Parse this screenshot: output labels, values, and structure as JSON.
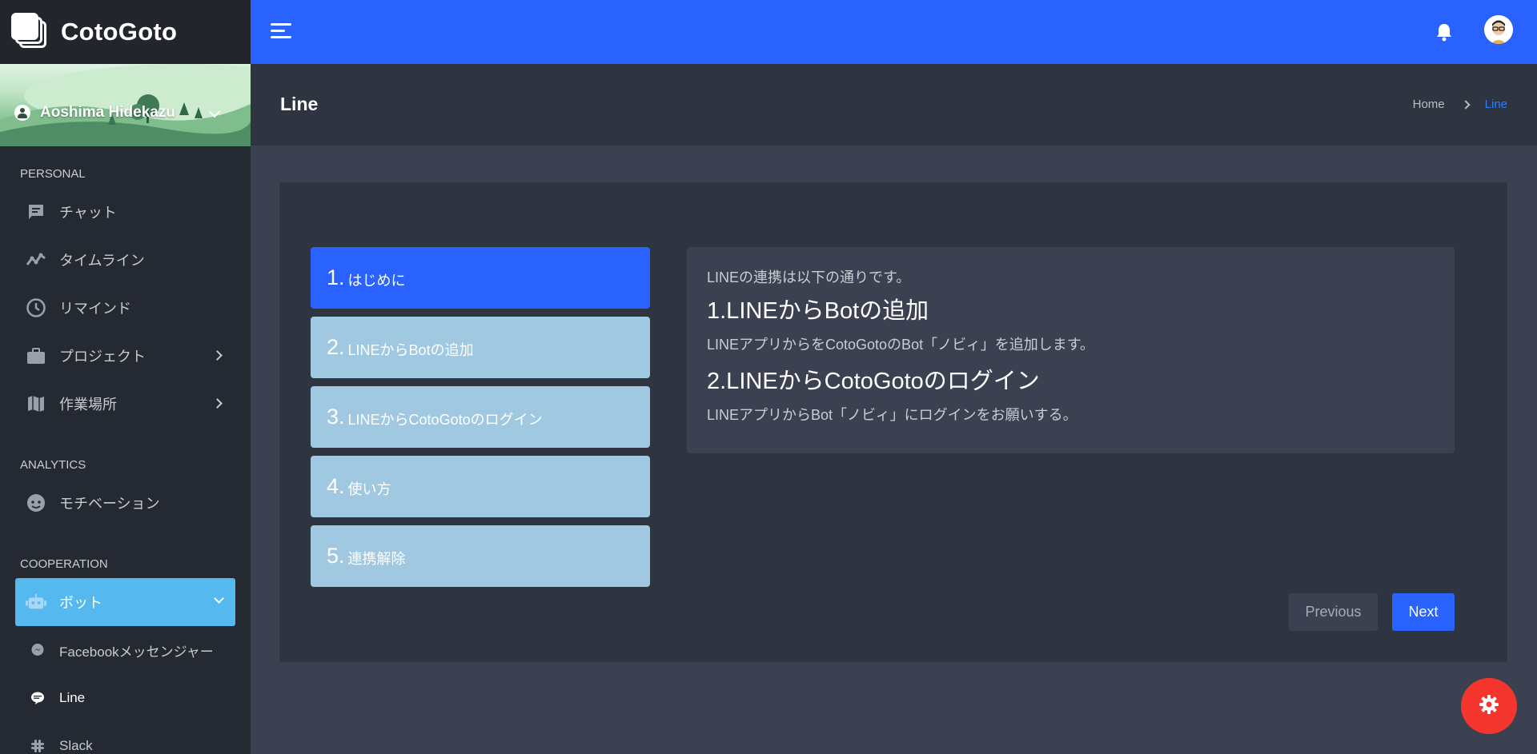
{
  "app": {
    "brand": "CotoGoto"
  },
  "user": {
    "name": "Aoshima Hidekazu"
  },
  "sidebar": {
    "sections": [
      {
        "label": "PERSONAL",
        "items": [
          {
            "label": "チャット",
            "icon": "chat-icon"
          },
          {
            "label": "タイムライン",
            "icon": "timeline-icon"
          },
          {
            "label": "リマインド",
            "icon": "clock-icon"
          },
          {
            "label": "プロジェクト",
            "icon": "briefcase-icon",
            "expandable": true
          },
          {
            "label": "作業場所",
            "icon": "map-icon",
            "expandable": true
          }
        ]
      },
      {
        "label": "ANALYTICS",
        "items": [
          {
            "label": "モチベーション",
            "icon": "face-icon"
          }
        ]
      },
      {
        "label": "COOPERATION",
        "items": [
          {
            "label": "ボット",
            "icon": "robot-icon",
            "expanded": true,
            "active": true
          }
        ],
        "subitems": [
          {
            "label": "Facebookメッセンジャー",
            "icon": "messenger-icon"
          },
          {
            "label": "Line",
            "icon": "line-icon",
            "current": true
          },
          {
            "label": "Slack",
            "icon": "slack-icon"
          }
        ]
      }
    ]
  },
  "page": {
    "title": "Line",
    "breadcrumb": {
      "home": "Home",
      "current": "Line"
    }
  },
  "wizard": {
    "steps": [
      {
        "num": "1.",
        "label": "はじめに",
        "active": true
      },
      {
        "num": "2.",
        "label": "LINEからBotの追加"
      },
      {
        "num": "3.",
        "label": "LINEからCotoGotoのログイン"
      },
      {
        "num": "4.",
        "label": "使い方"
      },
      {
        "num": "5.",
        "label": "連携解除"
      }
    ],
    "content": {
      "intro": "LINEの連携は以下の通りです。",
      "heading1": "1.LINEからBotの追加",
      "text1": "LINEアプリからをCotoGotoのBot「ノビィ」を追加します。",
      "heading2": "2.LINEからCotoGotoのログイン",
      "text2": "LINEアプリからBot「ノビィ」にログインをお願いする。"
    },
    "buttons": {
      "previous": "Previous",
      "next": "Next"
    }
  },
  "colors": {
    "topbar": "#2962ff",
    "sidebar_bg": "#252932",
    "active_nav": "#55b9f0",
    "step_active": "#2962ff",
    "step_inactive": "#a0c9e1",
    "fab": "#f5362f"
  }
}
